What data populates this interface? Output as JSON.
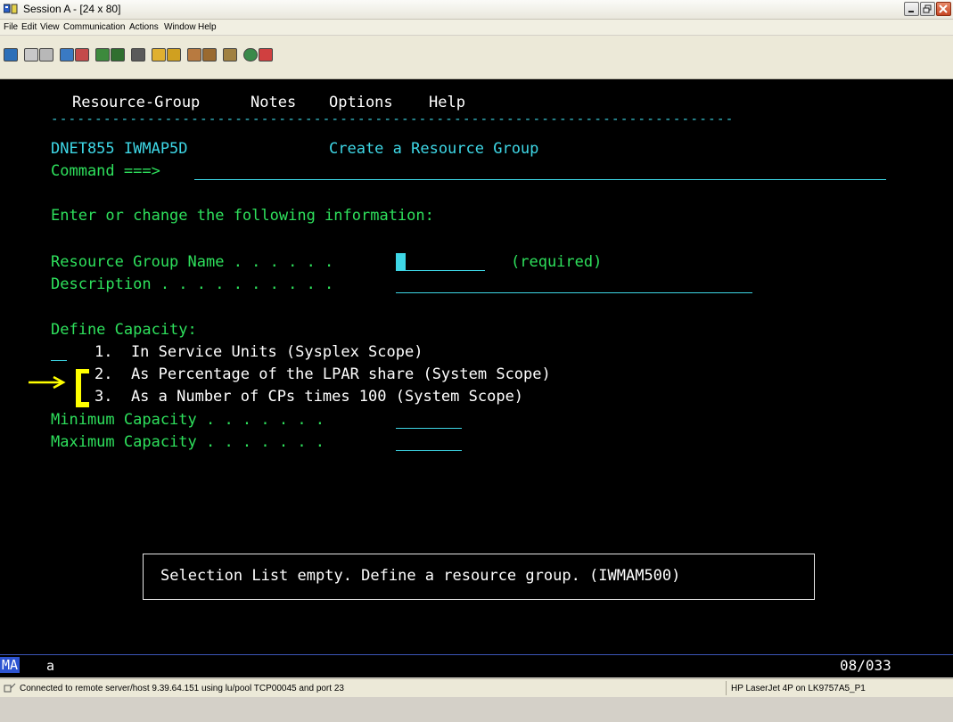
{
  "window": {
    "title": "Session A - [24 x 80]",
    "buttons": {
      "minimize_icon": "minimize-icon",
      "restore_icon": "restore-icon",
      "close_icon": "close-icon"
    }
  },
  "menu": [
    "File",
    "Edit",
    "View",
    "Communication",
    "Actions",
    "Window",
    "Help"
  ],
  "terminal": {
    "action_bar": [
      "Resource-Group",
      "Notes",
      "Options",
      "Help"
    ],
    "separator": "------------------------------------------------------------------------------",
    "panel_id": "DNET855 IWMAP5D",
    "panel_title": "Create a Resource Group",
    "command_label": "Command ===>",
    "command_value": "",
    "instruction": "Enter or change the following information:",
    "resource_group_name_label": "Resource Group Name . . . . . .",
    "resource_group_name_value": "",
    "required_text": "(required)",
    "description_label": "Description . . . . . . . . . .",
    "description_value": "",
    "define_capacity_label": "Define Capacity:",
    "capacity_options": [
      "1.  In Service Units (Sysplex Scope)",
      "2.  As Percentage of the LPAR share (System Scope)",
      "3.  As a Number of CPs times 100 (System Scope)"
    ],
    "capacity_choice_value": "",
    "minimum_capacity_label": "Minimum Capacity . . . . . . .",
    "minimum_capacity_value": "",
    "maximum_capacity_label": "Maximum Capacity . . . . . . .",
    "maximum_capacity_value": "",
    "message": "Selection List empty. Define a resource group. (IWMAM500)"
  },
  "oia": {
    "mode": "MA",
    "session": "a",
    "cursor_position": "08/033"
  },
  "status": {
    "connection": "Connected to remote server/host 9.39.64.151 using lu/pool TCP00045 and port 23",
    "printer": "HP LaserJet 4P on LK9757A5_P1"
  },
  "colors": {
    "terminal_bg": "#000000",
    "green": "#2ee05c",
    "turquoise": "#3ed7e6",
    "white": "#ffffff",
    "annotation_yellow": "#ffff00"
  }
}
